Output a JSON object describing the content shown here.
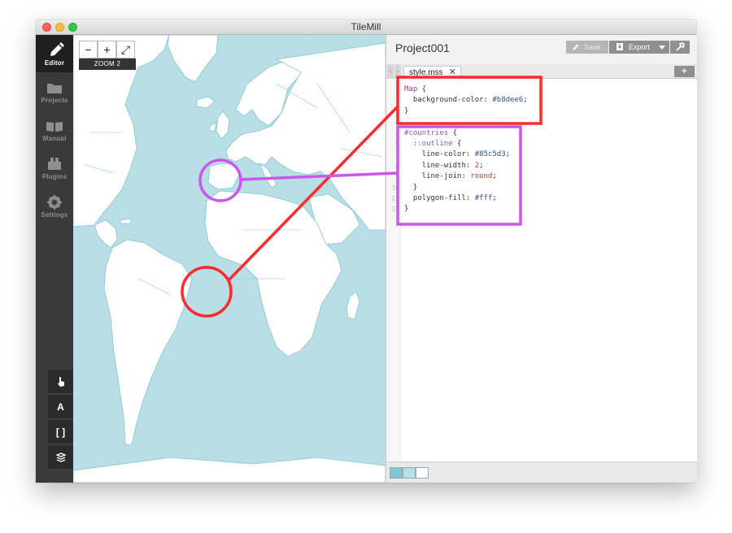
{
  "window": {
    "title": "TileMill"
  },
  "sidebar": {
    "items": [
      {
        "label": "Editor",
        "icon": "pencil-icon",
        "active": true
      },
      {
        "label": "Projects",
        "icon": "folder-icon",
        "active": false
      },
      {
        "label": "Manual",
        "icon": "book-icon",
        "active": false
      },
      {
        "label": "Plugins",
        "icon": "plugin-icon",
        "active": false
      },
      {
        "label": "Settings",
        "icon": "gear-icon",
        "active": false
      }
    ],
    "tools": [
      {
        "icon": "pointer-hand-icon"
      },
      {
        "icon": "font-icon",
        "label": "A"
      },
      {
        "icon": "brackets-icon",
        "label": "[ ]"
      },
      {
        "icon": "layers-icon"
      }
    ]
  },
  "map": {
    "zoom_label": "ZOOM 2",
    "zoom_out": "−",
    "zoom_in": "+",
    "fullscreen": "⤢",
    "background": "#b8dee6",
    "land": "#ffffff",
    "outline": "#85c5d3"
  },
  "project": {
    "title": "Project001",
    "save_label": "Save",
    "export_label": "Export",
    "tab_label": "style.mss",
    "tab_close": "✕",
    "add_tab": "+",
    "swatches": [
      "#85c5d3",
      "#b8dee6",
      "#ffffff"
    ]
  },
  "editor": {
    "line_numbers": [
      "1",
      "2",
      "3",
      "4",
      "5",
      "6",
      "7",
      "8",
      "9",
      "10",
      "11",
      "12"
    ],
    "lines": [
      {
        "parts": [
          {
            "t": "Map",
            "c": "k-sel"
          },
          {
            "t": " {",
            "c": "k-prop"
          }
        ]
      },
      {
        "parts": [
          {
            "t": "  background-color: ",
            "c": "k-prop"
          },
          {
            "t": "#b8dee6",
            "c": "k-hex"
          },
          {
            "t": ";",
            "c": "k-prop"
          }
        ]
      },
      {
        "parts": [
          {
            "t": "}",
            "c": "k-prop"
          }
        ]
      },
      {
        "parts": []
      },
      {
        "parts": [
          {
            "t": "#countries",
            "c": "k-id"
          },
          {
            "t": " {",
            "c": "k-prop"
          }
        ]
      },
      {
        "parts": [
          {
            "t": "  ::outline",
            "c": "k-id"
          },
          {
            "t": " {",
            "c": "k-prop"
          }
        ]
      },
      {
        "parts": [
          {
            "t": "    line-color: ",
            "c": "k-prop"
          },
          {
            "t": "#85c5d3",
            "c": "k-hex"
          },
          {
            "t": ";",
            "c": "k-prop"
          }
        ]
      },
      {
        "parts": [
          {
            "t": "    line-width: ",
            "c": "k-prop"
          },
          {
            "t": "2",
            "c": "k-num"
          },
          {
            "t": ";",
            "c": "k-prop"
          }
        ]
      },
      {
        "parts": [
          {
            "t": "    line-join: ",
            "c": "k-prop"
          },
          {
            "t": "round",
            "c": "k-kw"
          },
          {
            "t": ";",
            "c": "k-prop"
          }
        ]
      },
      {
        "parts": [
          {
            "t": "  }",
            "c": "k-prop"
          }
        ]
      },
      {
        "parts": [
          {
            "t": "  polygon-fill: ",
            "c": "k-prop"
          },
          {
            "t": "#fff",
            "c": "k-hex"
          },
          {
            "t": ";",
            "c": "k-prop"
          }
        ]
      },
      {
        "parts": [
          {
            "t": "}",
            "c": "k-prop"
          }
        ]
      }
    ]
  },
  "annotations": {
    "red": "#ff2a2a",
    "purple": "#cc55ee"
  }
}
